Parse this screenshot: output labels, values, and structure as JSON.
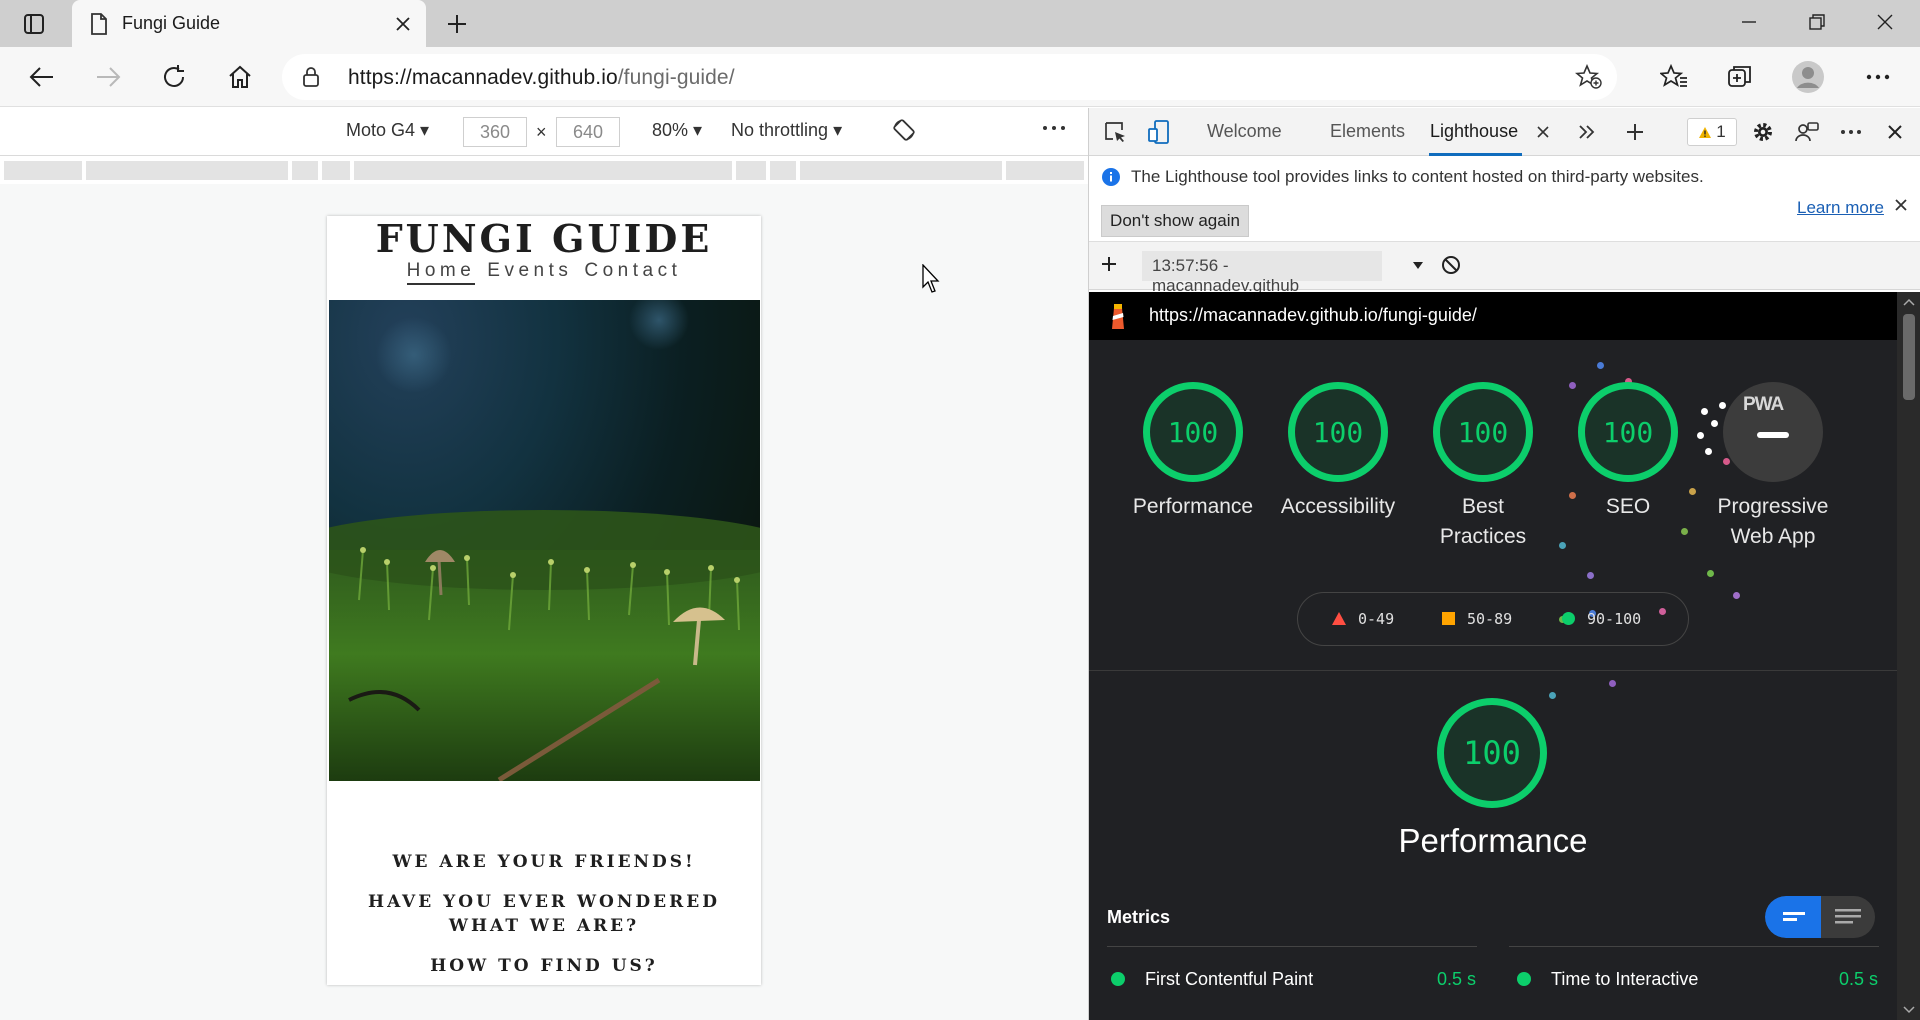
{
  "browser": {
    "tab_title": "Fungi Guide",
    "url_host": "https://macannadev.github.io",
    "url_path": "/fungi-guide/"
  },
  "device_toolbar": {
    "device": "Moto G4",
    "width": "360",
    "height": "640",
    "times": "×",
    "zoom": "80%",
    "throttling": "No throttling"
  },
  "site": {
    "title": "FUNGI GUIDE",
    "nav": [
      "Home",
      "Events",
      "Contact"
    ],
    "headings": [
      "WE ARE YOUR FRIENDS!",
      "HAVE YOU EVER WONDERED WHAT WE ARE?",
      "HOW TO FIND US?"
    ]
  },
  "devtools": {
    "tabs": [
      "Welcome",
      "Elements",
      "Lighthouse"
    ],
    "active_tab": "Lighthouse",
    "warning_count": "1",
    "info_message": "The Lighthouse tool provides links to content hosted on third-party websites.",
    "learn_more": "Learn more",
    "dont_show": "Don't show again",
    "run_label": "13:57:56 - macannadev.github",
    "report_url": "https://macannadev.github.io/fungi-guide/"
  },
  "report": {
    "scores": [
      {
        "label1": "Performance",
        "label2": "",
        "score": "100"
      },
      {
        "label1": "Accessibility",
        "label2": "",
        "score": "100"
      },
      {
        "label1": "Best",
        "label2": "Practices",
        "score": "100"
      },
      {
        "label1": "SEO",
        "label2": "",
        "score": "100"
      }
    ],
    "pwa": {
      "label1": "Progressive",
      "label2": "Web App",
      "badge": "PWA"
    },
    "legend": [
      "0-49",
      "50-89",
      "90-100"
    ],
    "main_score": "100",
    "main_label": "Performance",
    "metrics_title": "Metrics",
    "metrics": [
      {
        "name": "First Contentful Paint",
        "value": "0.5 s"
      },
      {
        "name": "Time to Interactive",
        "value": "0.5 s"
      }
    ]
  },
  "colors": {
    "pass": "#0cce6b",
    "average": "#ffa400",
    "fail": "#ff4e42",
    "accent": "#0f6cbd"
  }
}
